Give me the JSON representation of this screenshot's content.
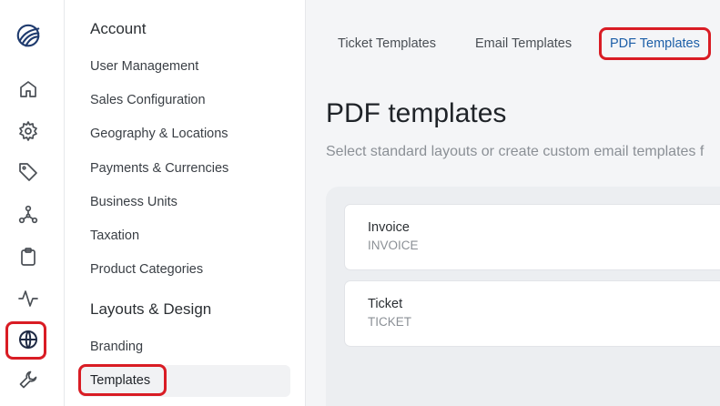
{
  "rail": {
    "icons": [
      "logo-globe-icon",
      "home-icon",
      "gear-icon",
      "tag-icon",
      "network-icon",
      "clipboard-icon",
      "activity-icon",
      "globe-icon",
      "wrench-icon"
    ],
    "active": "globe-icon"
  },
  "nav": {
    "sections": [
      {
        "heading": "Account",
        "items": [
          "User Management",
          "Sales Configuration",
          "Geography & Locations",
          "Payments & Currencies",
          "Business Units",
          "Taxation",
          "Product Categories"
        ]
      },
      {
        "heading": "Layouts & Design",
        "items": [
          "Branding",
          "Templates"
        ]
      }
    ],
    "selected": "Templates"
  },
  "tabs": [
    "Ticket Templates",
    "Email Templates",
    "PDF Templates"
  ],
  "active_tab": "PDF Templates",
  "page": {
    "title": "PDF templates",
    "subtitle": "Select standard layouts or create custom email templates f"
  },
  "templates": [
    {
      "name": "Invoice",
      "code": "INVOICE"
    },
    {
      "name": "Ticket",
      "code": "TICKET"
    }
  ],
  "colors": {
    "accent": "#1d5fa8",
    "highlight": "#d91c24"
  }
}
